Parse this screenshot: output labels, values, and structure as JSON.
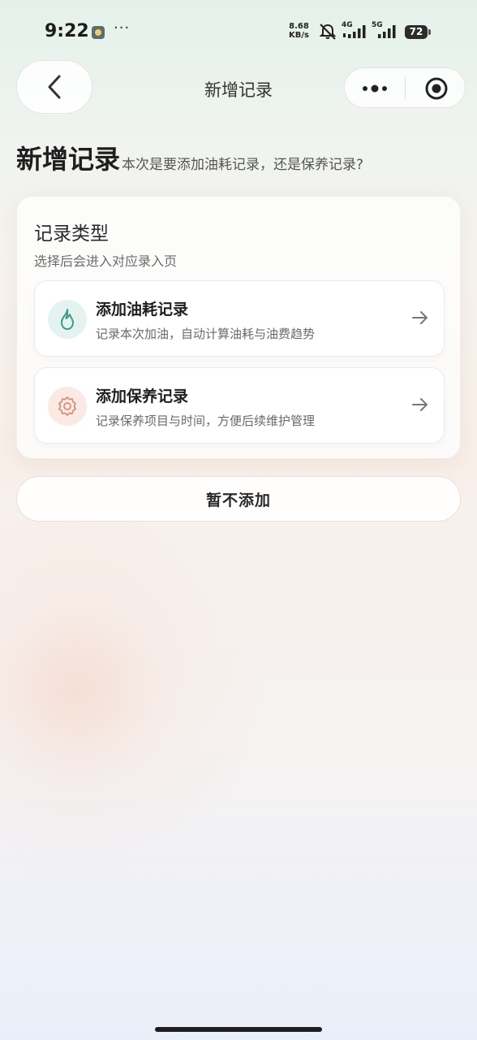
{
  "status_bar": {
    "time": "9:22",
    "more": "···",
    "net_speed_value": "8.68",
    "net_speed_unit": "KB/s",
    "signal_1_label": "4G",
    "signal_2_label": "5G",
    "battery": "72"
  },
  "nav": {
    "title": "新增记录",
    "back_icon": "chevron-left-icon",
    "more_icon": "more-dots-icon",
    "close_icon": "target-circle-icon"
  },
  "header": {
    "title": "新增记录",
    "subtitle": "本次是要添加油耗记录，还是保养记录?"
  },
  "card": {
    "title": "记录类型",
    "subtitle": "选择后会进入对应录入页",
    "options": [
      {
        "title": "添加油耗记录",
        "desc": "记录本次加油，自动计算油耗与油费趋势",
        "icon": "flame-icon",
        "icon_bg": "#e4f3ef",
        "icon_color": "#3f9a8a"
      },
      {
        "title": "添加保养记录",
        "desc": "记录保养项目与时间，方便后续维护管理",
        "icon": "gear-icon",
        "icon_bg": "#fbe9e3",
        "icon_color": "#d58f78"
      }
    ]
  },
  "skip_button": "暂不添加",
  "colors": {
    "accent_teal": "#3f9a8a",
    "accent_coral": "#d58f78"
  }
}
